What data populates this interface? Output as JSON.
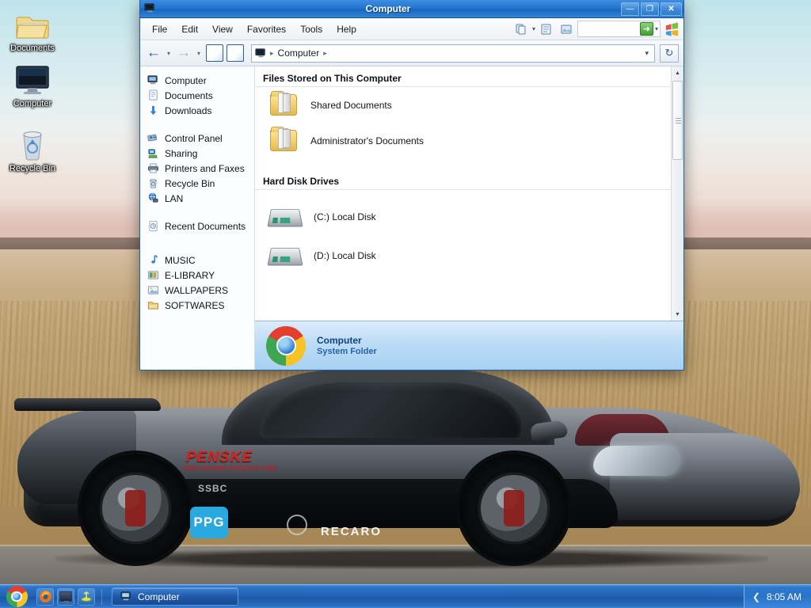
{
  "desktop": {
    "icons": [
      {
        "label": "Documents",
        "icon": "folder-documents-icon"
      },
      {
        "label": "Computer",
        "icon": "monitor-computer-icon"
      },
      {
        "label": "Recycle Bin",
        "icon": "recycle-bin-icon"
      }
    ]
  },
  "window": {
    "title": "Computer",
    "title_icon": "computer-icon",
    "controls": {
      "minimize": "—",
      "maximize": "❐",
      "close": "✕"
    },
    "menu": [
      "File",
      "Edit",
      "View",
      "Favorites",
      "Tools",
      "Help"
    ],
    "toolbar": {
      "organize_icon": "copy-pages-icon",
      "views_icon": "views-icon",
      "preview_icon": "preview-pane-icon",
      "go_label": "➜",
      "go_caret": "▾",
      "brand_icon": "windows-flag-icon"
    },
    "nav": {
      "back": "←",
      "back_caret": "▾",
      "forward": "→",
      "forward_caret": "▾",
      "new_doc_icon": "new-document-icon",
      "edit_doc_icon": "edit-document-icon",
      "refresh": "↻"
    },
    "address": {
      "icon": "computer-icon",
      "crumbs": [
        "Computer"
      ],
      "separator": "▸",
      "dropdown_caret": "▾"
    },
    "sidebar": {
      "groups": [
        {
          "items": [
            {
              "label": "Computer",
              "icon": "computer-icon"
            },
            {
              "label": "Documents",
              "icon": "documents-icon"
            },
            {
              "label": "Downloads",
              "icon": "downloads-arrow-icon"
            }
          ]
        },
        {
          "items": [
            {
              "label": "Control Panel",
              "icon": "control-panel-icon"
            },
            {
              "label": "Sharing",
              "icon": "sharing-icon"
            },
            {
              "label": "Printers and Faxes",
              "icon": "printer-icon"
            },
            {
              "label": "Recycle Bin",
              "icon": "recycle-bin-icon"
            },
            {
              "label": "LAN",
              "icon": "network-globe-icon"
            }
          ]
        },
        {
          "items": [
            {
              "label": "Recent Documents",
              "icon": "recent-documents-icon"
            }
          ]
        },
        {
          "items": [
            {
              "label": "MUSIC",
              "icon": "music-note-icon"
            },
            {
              "label": "E-LIBRARY",
              "icon": "library-folder-icon"
            },
            {
              "label": "WALLPAPERS",
              "icon": "picture-folder-icon"
            },
            {
              "label": "SOFTWARES",
              "icon": "software-folder-icon"
            }
          ]
        }
      ]
    },
    "content": {
      "sections": [
        {
          "heading": "Files Stored on This Computer",
          "items": [
            {
              "name": "Shared Documents",
              "icon": "folder-icon"
            },
            {
              "name": "Administrator's Documents",
              "icon": "folder-icon"
            }
          ]
        },
        {
          "heading": "Hard Disk Drives",
          "items": [
            {
              "name": "(C:) Local Disk",
              "icon": "hard-disk-icon"
            },
            {
              "name": "(D:) Local Disk",
              "icon": "hard-disk-icon"
            }
          ]
        }
      ],
      "scrollbar": {
        "up": "▲",
        "down": "▼"
      }
    },
    "status": {
      "icon": "chrome-logo-icon",
      "title": "Computer",
      "subtitle": "System Folder"
    }
  },
  "taskbar": {
    "start_icon": "chrome-start-icon",
    "quick_launch": [
      {
        "icon": "firefox-icon"
      },
      {
        "icon": "show-desktop-icon"
      },
      {
        "icon": "media-icon"
      }
    ],
    "tasks": [
      {
        "label": "Computer",
        "icon": "computer-icon"
      }
    ],
    "tray": {
      "chevron": "❮",
      "clock": "8:05 AM"
    }
  },
  "wallpaper": {
    "decals": {
      "penske": "PENSKE",
      "penske_sub": "SSC RACING SHOCKS 2006",
      "ssbc": "SSBC",
      "ppg": "PPG",
      "recaro": "RECARO"
    }
  },
  "colors": {
    "titlebar": "#2176d2",
    "taskbar": "#2163b5",
    "status_title": "#12437e",
    "accent_green": "#3f9e33",
    "decal_red": "#e0201b",
    "ppg_blue": "#2aa8e0"
  }
}
